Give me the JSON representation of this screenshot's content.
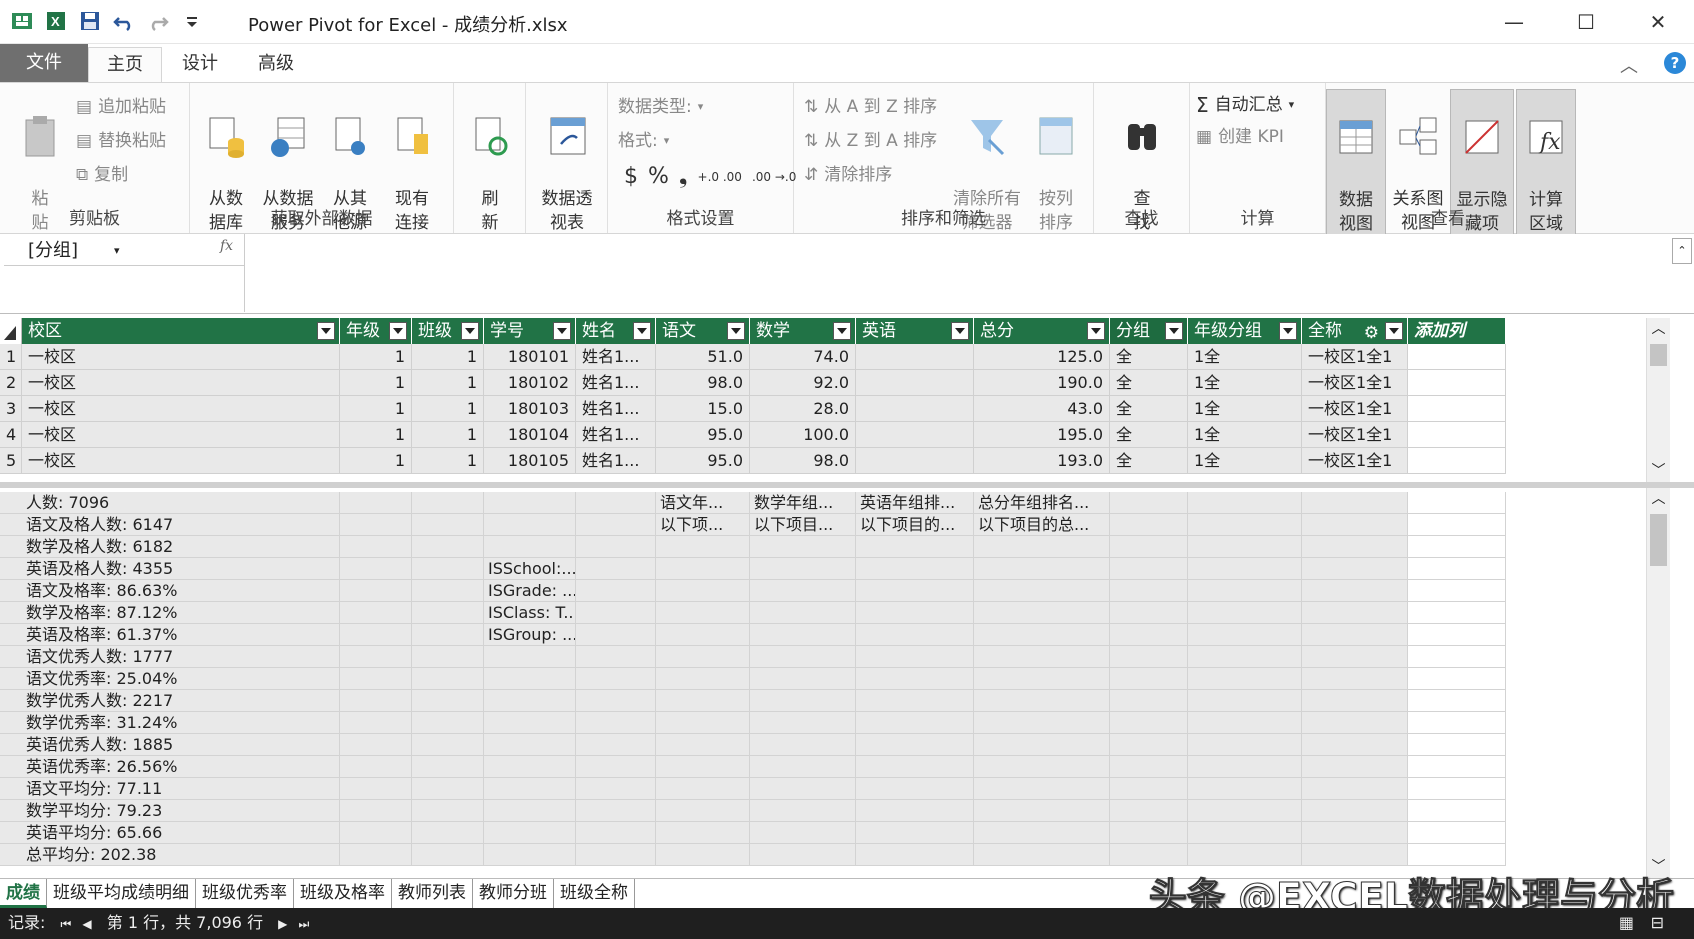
{
  "window": {
    "title": "Power Pivot for Excel - 成绩分析.xlsx",
    "minimize": "—",
    "maximize": "☐",
    "close": "✕"
  },
  "tabs": [
    {
      "label": "文件"
    },
    {
      "label": "主页"
    },
    {
      "label": "设计"
    },
    {
      "label": "高级"
    }
  ],
  "ribbon": {
    "clipboard": {
      "label": "剪贴板",
      "paste": "粘\n贴",
      "append_paste": "追加粘贴",
      "replace_paste": "替换粘贴",
      "copy": "复制"
    },
    "external": {
      "label": "获取外部数据",
      "from_db": "从数\n据库",
      "from_service": "从数据\n服务",
      "from_other": "从其\n他源",
      "existing": "现有\n连接"
    },
    "refresh": {
      "label": "刷\n新"
    },
    "pivot": {
      "label": "数据透\n视表"
    },
    "format": {
      "label": "格式设置",
      "datatype": "数据类型:",
      "format": "格式:",
      "currency": "$",
      "percent": "%",
      "comma": "❟",
      "inc": "+.0 .00",
      "dec": ".00 →.0"
    },
    "sort": {
      "label": "排序和筛选",
      "a_to_z": "从 A 到 Z 排序",
      "z_to_a": "从 Z 到 A 排序",
      "clear_sort": "清除排序",
      "clear_filters": "清除所有\n筛选器",
      "sort_by_col": "按列\n排序"
    },
    "find": {
      "label": "查找",
      "find": "查\n找"
    },
    "calc": {
      "label": "计算",
      "autosum": "自动汇总",
      "kpi": "创建 KPI"
    },
    "view": {
      "label": "查看",
      "data_view": "数据\n视图",
      "diagram_view": "关系图\n视图",
      "show_hidden": "显示隐\n藏项",
      "calc_area": "计算\n区域"
    }
  },
  "formula_bar": {
    "name_box": "[分组]",
    "fx": "fx",
    "formula": ""
  },
  "columns": [
    "校区",
    "年级",
    "班级",
    "学号",
    "姓名",
    "语文",
    "数学",
    "英语",
    "总分",
    "分组",
    "年级分组",
    "全称",
    "添加列"
  ],
  "rows": [
    {
      "n": "1",
      "campus": "一校区",
      "grade": "1",
      "class": "1",
      "id": "180101",
      "name": "姓名1...",
      "chinese": "51.0",
      "math": "74.0",
      "english": "",
      "total": "125.0",
      "group": "全",
      "grade_group": "1全",
      "full": "一校区1全1"
    },
    {
      "n": "2",
      "campus": "一校区",
      "grade": "1",
      "class": "1",
      "id": "180102",
      "name": "姓名1...",
      "chinese": "98.0",
      "math": "92.0",
      "english": "",
      "total": "190.0",
      "group": "全",
      "grade_group": "1全",
      "full": "一校区1全1"
    },
    {
      "n": "3",
      "campus": "一校区",
      "grade": "1",
      "class": "1",
      "id": "180103",
      "name": "姓名1...",
      "chinese": "15.0",
      "math": "28.0",
      "english": "",
      "total": "43.0",
      "group": "全",
      "grade_group": "1全",
      "full": "一校区1全1"
    },
    {
      "n": "4",
      "campus": "一校区",
      "grade": "1",
      "class": "1",
      "id": "180104",
      "name": "姓名1...",
      "chinese": "95.0",
      "math": "100.0",
      "english": "",
      "total": "195.0",
      "group": "全",
      "grade_group": "1全",
      "full": "一校区1全1"
    },
    {
      "n": "5",
      "campus": "一校区",
      "grade": "1",
      "class": "1",
      "id": "180105",
      "name": "姓名1...",
      "chinese": "95.0",
      "math": "98.0",
      "english": "",
      "total": "193.0",
      "group": "全",
      "grade_group": "1全",
      "full": "一校区1全1"
    }
  ],
  "measures": {
    "col1": [
      "人数: 7096",
      "语文及格人数: 6147",
      "数学及格人数: 6182",
      "英语及格人数: 4355",
      "语文及格率: 86.63%",
      "数学及格率: 87.12%",
      "英语及格率: 61.37%",
      "语文优秀人数: 1777",
      "语文优秀率: 25.04%",
      "数学优秀人数: 2217",
      "数学优秀率: 31.24%",
      "英语优秀人数: 1885",
      "英语优秀率: 26.56%",
      "语文平均分: 77.11",
      "数学平均分: 79.23",
      "英语平均分: 65.66",
      "总平均分: 202.38"
    ],
    "col_id": [
      "",
      "",
      "",
      "ISSchool:...",
      "ISGrade: ...",
      "ISClass: T...",
      "ISGroup: ..."
    ],
    "col_chinese": [
      "语文年...",
      "以下项..."
    ],
    "col_math": [
      "数学年组...",
      "以下项目..."
    ],
    "col_english": [
      "英语年组排...",
      "以下项目的..."
    ],
    "col_total": [
      "总分年组排名...",
      "以下项目的总..."
    ]
  },
  "sheet_tabs": [
    "成绩",
    "班级平均成绩明细",
    "班级优秀率",
    "班级及格率",
    "教师列表",
    "教师分班",
    "班级全称"
  ],
  "watermark": "头条 @EXCEL数据处理与分析",
  "status": {
    "record_label": "记录:",
    "position": "第 1 行，共 7,096 行"
  }
}
